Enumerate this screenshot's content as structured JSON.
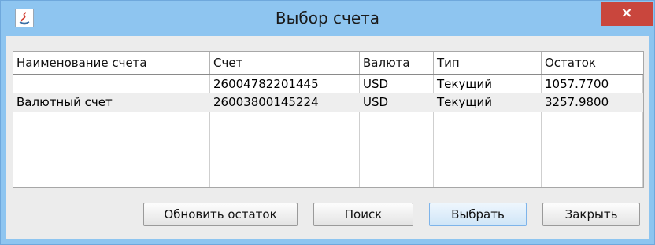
{
  "window": {
    "title": "Выбор счета",
    "close_label": "×"
  },
  "table": {
    "columns": [
      "Наименование счета",
      "Счет",
      "Валюта",
      "Тип",
      "Остаток"
    ],
    "rows": [
      {
        "name": "",
        "account": "26004782201445",
        "currency": "USD",
        "type": "Текущий",
        "balance": "1057.7700"
      },
      {
        "name": "Валютный счет",
        "account": "26003800145224",
        "currency": "USD",
        "type": "Текущий",
        "balance": "3257.9800"
      }
    ]
  },
  "buttons": {
    "refresh": "Обновить остаток",
    "search": "Поиск",
    "select": "Выбрать",
    "close": "Закрыть"
  },
  "colors": {
    "titlebar": "#8ec5f0",
    "close": "#c9463d"
  }
}
